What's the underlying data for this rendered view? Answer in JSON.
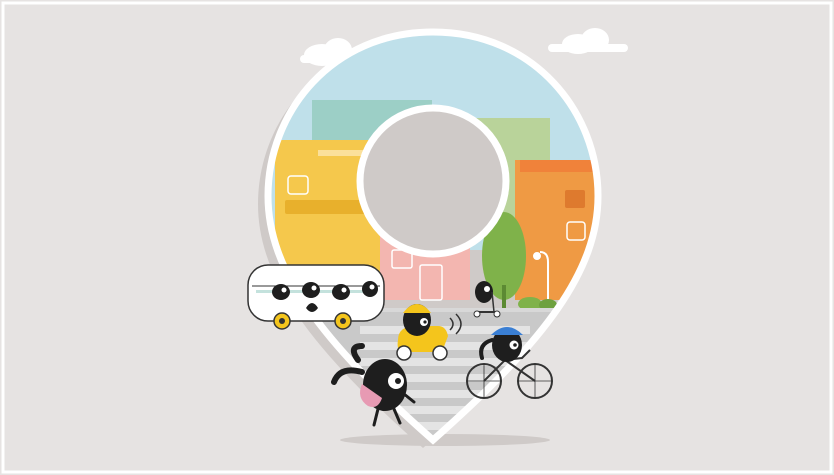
{
  "scene": {
    "subject": "location-pin-city-illustration",
    "colors": {
      "background": "#e6e3e2",
      "pin_outline": "#ffffff",
      "pin_shadow": "#cfcac8",
      "sky": "#bfe0ea",
      "building_yellow": "#f5c84c",
      "building_orange": "#ef9a44",
      "building_teal": "#9ccfc6",
      "building_green": "#b9d39a",
      "building_pink": "#f3b6b0",
      "tree": "#7fb24a",
      "road": "#c9c9c9",
      "crosswalk": "#ffffff",
      "character": "#1e1e1e",
      "scooter": "#f4c51c",
      "helmet_blue": "#3a7fd4",
      "bag_pink": "#e79ab3"
    },
    "elements": [
      "cloud-left",
      "cloud-right",
      "location-pin",
      "bus-with-passengers",
      "scooter-rider",
      "cyclist",
      "pedestrian",
      "kick-scooter-rider",
      "tree",
      "street-lamp"
    ]
  }
}
